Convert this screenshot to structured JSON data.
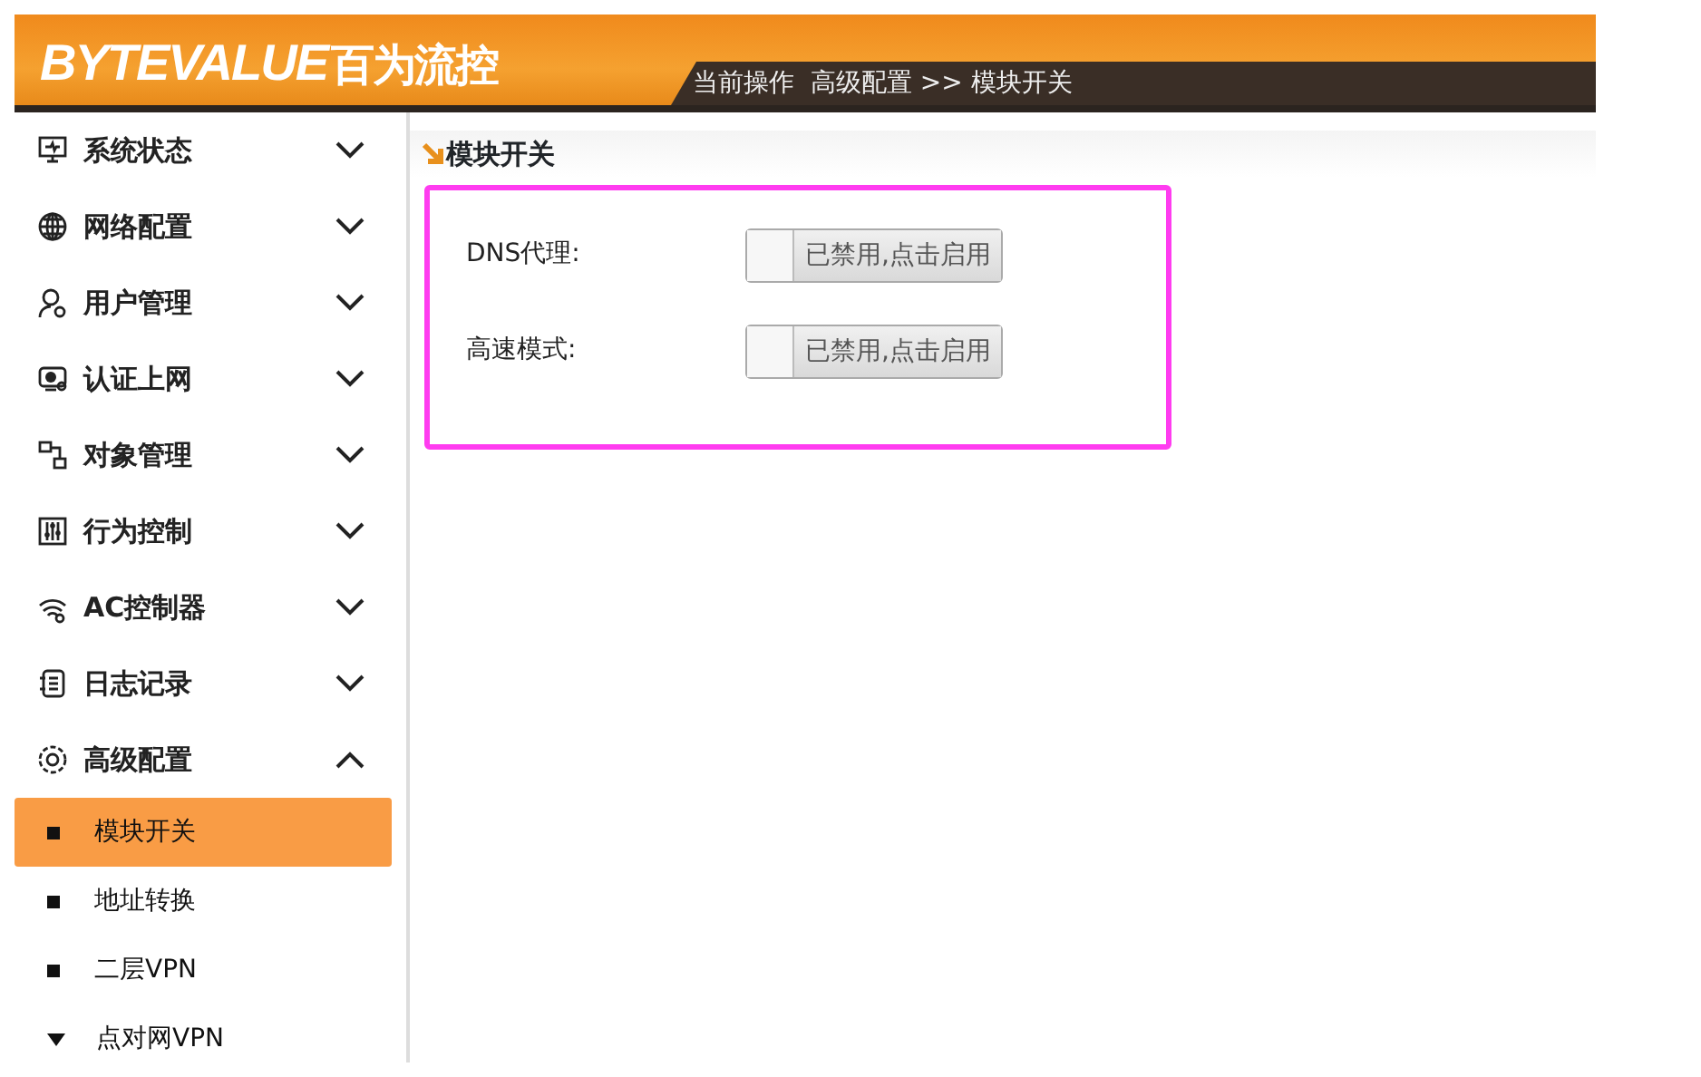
{
  "header": {
    "logo": "BYTEVALUE",
    "logo_cn": "百为流控",
    "breadcrumb": "当前操作  高级配置 >> 模块开关"
  },
  "sidebar": {
    "items": [
      {
        "label": "系统状态",
        "expanded": false
      },
      {
        "label": "网络配置",
        "expanded": false
      },
      {
        "label": "用户管理",
        "expanded": false
      },
      {
        "label": "认证上网",
        "expanded": false
      },
      {
        "label": "对象管理",
        "expanded": false
      },
      {
        "label": "行为控制",
        "expanded": false
      },
      {
        "label": "AC控制器",
        "expanded": false
      },
      {
        "label": "日志记录",
        "expanded": false
      },
      {
        "label": "高级配置",
        "expanded": true,
        "children": [
          {
            "kind": "leaf",
            "label": "模块开关",
            "selected": true
          },
          {
            "kind": "leaf",
            "label": "地址转换",
            "selected": false
          },
          {
            "kind": "leaf",
            "label": "二层VPN",
            "selected": false
          },
          {
            "kind": "group",
            "label": "点对网VPN",
            "selected": false
          }
        ]
      }
    ]
  },
  "panel": {
    "title": "模块开关",
    "settings": [
      {
        "label": "DNS代理:",
        "enabled": false,
        "toggle_text": "已禁用,点击启用"
      },
      {
        "label": "高速模式:",
        "enabled": false,
        "toggle_text": "已禁用,点击启用"
      }
    ]
  }
}
